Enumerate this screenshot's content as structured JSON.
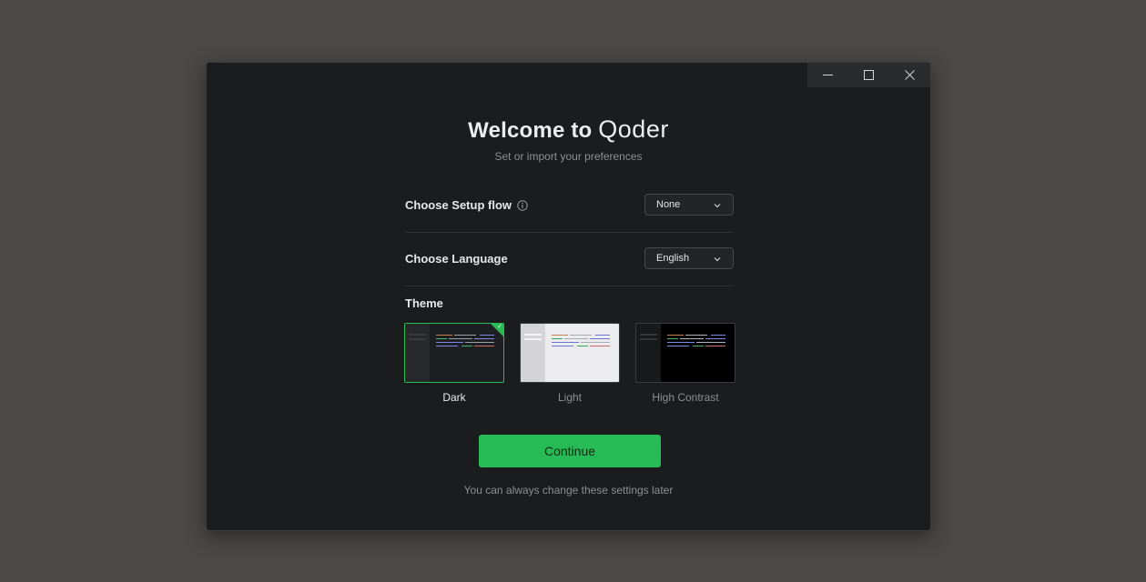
{
  "window": {
    "controls": [
      "minimize-icon",
      "maximize-icon",
      "close-icon"
    ]
  },
  "header": {
    "title_prefix": "Welcome to",
    "brand": "Qoder",
    "subtitle": "Set or import your preferences"
  },
  "setup_flow": {
    "label": "Choose Setup flow",
    "icon": "info-icon",
    "value": "None"
  },
  "language": {
    "label": "Choose Language",
    "value": "English"
  },
  "theme": {
    "label": "Theme",
    "options": [
      {
        "name": "Dark",
        "selected": true
      },
      {
        "name": "Light",
        "selected": false
      },
      {
        "name": "High Contrast",
        "selected": false
      }
    ]
  },
  "actions": {
    "continue_label": "Continue",
    "footnote": "You can always change these settings later"
  },
  "colors": {
    "accent": "#27bb55",
    "window_bg": "#1b1c1e",
    "desktop_bg": "#4b4946"
  }
}
